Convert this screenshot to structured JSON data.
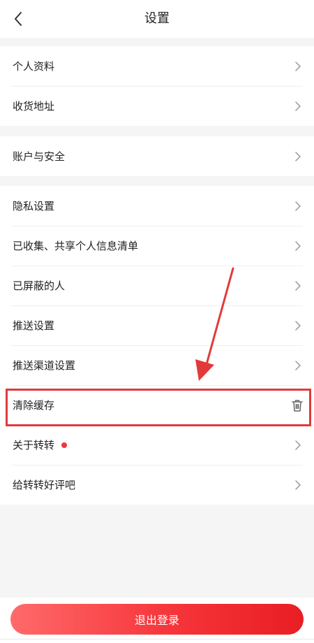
{
  "header": {
    "title": "设置",
    "back_icon": "chevron-left-icon"
  },
  "groups": [
    {
      "items": [
        {
          "label": "个人资料",
          "icon": "chevron-right-icon"
        },
        {
          "label": "收货地址",
          "icon": "chevron-right-icon"
        }
      ]
    },
    {
      "items": [
        {
          "label": "账户与安全",
          "icon": "chevron-right-icon"
        }
      ]
    },
    {
      "items": [
        {
          "label": "隐私设置",
          "icon": "chevron-right-icon"
        },
        {
          "label": "已收集、共享个人信息清单",
          "icon": "chevron-right-icon"
        },
        {
          "label": "已屏蔽的人",
          "icon": "chevron-right-icon"
        },
        {
          "label": "推送设置",
          "icon": "chevron-right-icon"
        },
        {
          "label": "推送渠道设置",
          "icon": "chevron-right-icon"
        },
        {
          "label": "清除缓存",
          "icon": "trash-icon"
        },
        {
          "label": "关于转转",
          "icon": "chevron-right-icon",
          "badge": "red-dot"
        },
        {
          "label": "给转转好评吧",
          "icon": "chevron-right-icon"
        }
      ]
    }
  ],
  "footer": {
    "logout_label": "退出登录"
  },
  "colors": {
    "accent_red": "#f0353a",
    "annotation_red": "#e23a3a",
    "background": "#f5f5f5"
  }
}
